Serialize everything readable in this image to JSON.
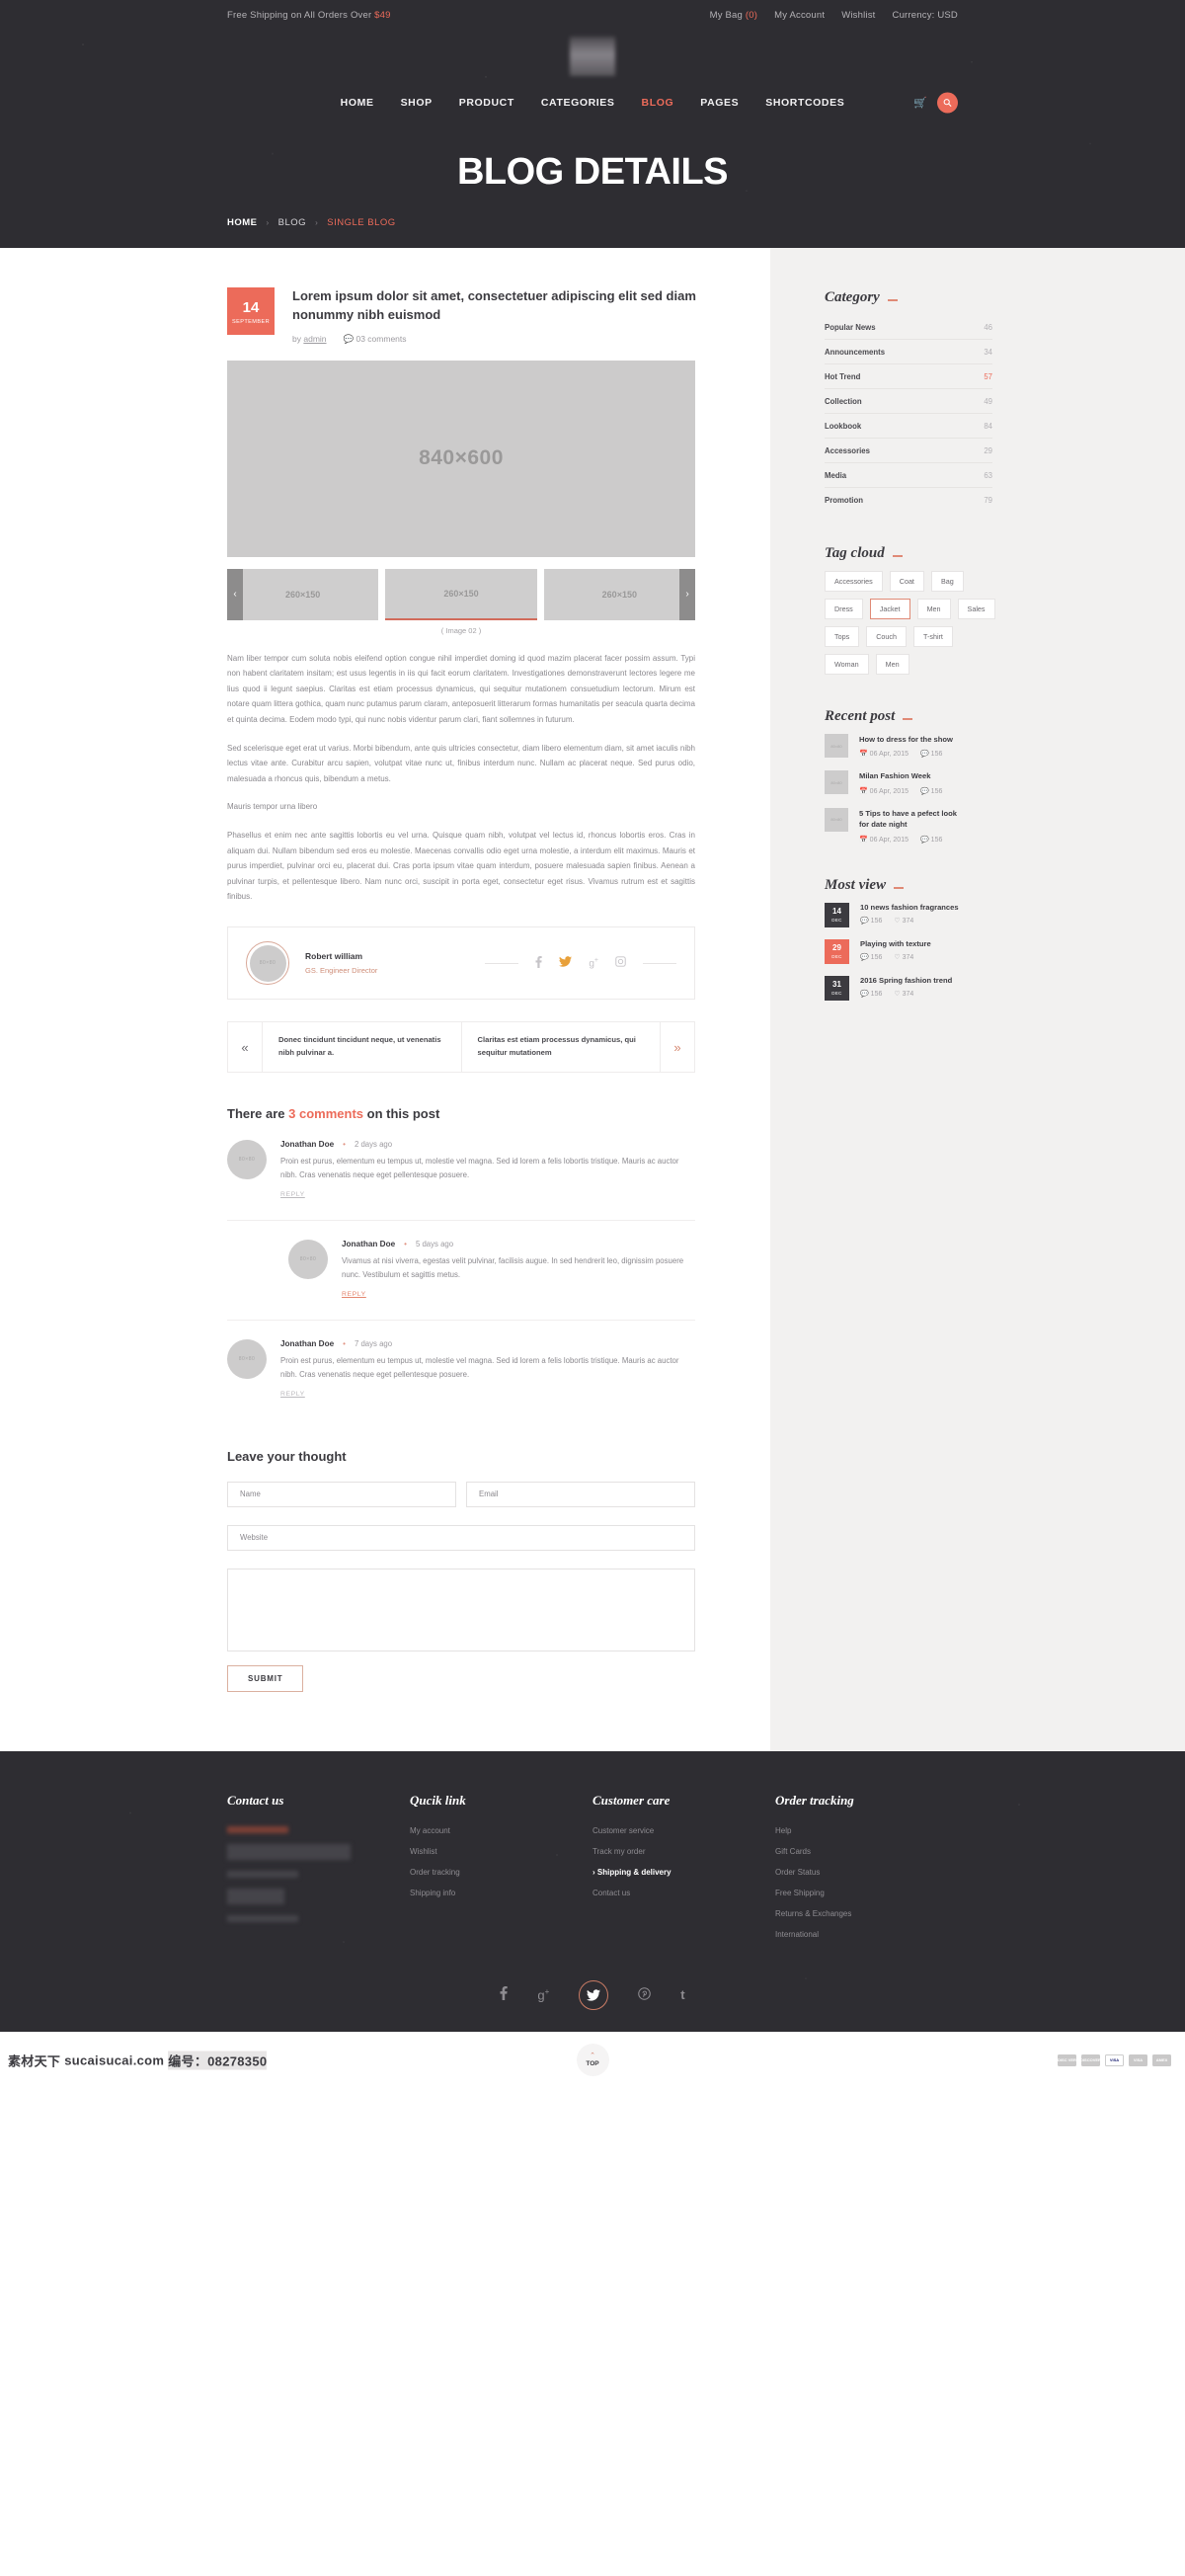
{
  "topbar": {
    "promo_prefix": "Free Shipping on All Orders Over ",
    "promo_amount": "$49",
    "bag_label": "My Bag ",
    "bag_count": "(0)",
    "account": "My Account",
    "wishlist": "Wishlist",
    "currency": "Currency: USD"
  },
  "nav": {
    "items": [
      {
        "label": "HOME"
      },
      {
        "label": "SHOP"
      },
      {
        "label": "PRODUCT"
      },
      {
        "label": "CATEGORIES"
      },
      {
        "label": "BLOG"
      },
      {
        "label": "PAGES"
      },
      {
        "label": "SHORTCODES"
      }
    ],
    "active": "BLOG",
    "cart_icon": "cart-icon",
    "search_icon": "search-icon"
  },
  "hero": {
    "title": "BLOG DETAILS",
    "breadcrumb": [
      {
        "label": "HOME"
      },
      {
        "label": "BLOG"
      },
      {
        "label": "SINGLE BLOG"
      }
    ]
  },
  "post": {
    "day": "14",
    "month": "SEPTEMBER",
    "title": "Lorem ipsum dolor sit amet, consectetuer adipiscing elit sed diam nonummy nibh euismod",
    "by_label": "by",
    "author": "admin",
    "comments_count": "03 comments",
    "feature_image_label": "840×600",
    "thumbs": [
      {
        "label": "260×150"
      },
      {
        "label": "260×150"
      },
      {
        "label": "260×150"
      }
    ],
    "prev_arrow": "‹",
    "next_arrow": "›",
    "image_caption": "( Image 02 )",
    "paragraphs": [
      "Nam liber tempor cum soluta nobis eleifend option congue nihil imperdiet doming id quod mazim placerat facer possim assum. Typi non habent claritatem insitam; est usus legentis in iis qui facit eorum claritatem. Investigationes demonstraverunt lectores legere me lius quod ii legunt saepius. Claritas est etiam processus dynamicus, qui sequitur mutationem consuetudium lectorum. Mirum est notare quam littera gothica, quam nunc putamus parum claram, anteposuerit litterarum formas humanitatis per seacula quarta decima et quinta decima. Eodem modo typi, qui nunc nobis videntur parum clari, fiant sollemnes in futurum.",
      "Sed scelerisque eget erat ut varius. Morbi bibendum, ante quis ultricies consectetur, diam libero elementum diam, sit amet iaculis nibh lectus vitae ante. Curabitur arcu sapien, volutpat vitae nunc ut, finibus interdum nunc. Nullam ac placerat neque. Sed purus odio, malesuada a rhoncus quis, bibendum a metus.",
      "Mauris tempor urna libero",
      "Phasellus et enim nec ante sagittis lobortis eu vel urna. Quisque quam nibh, volutpat vel lectus id, rhoncus lobortis eros. Cras in aliquam dui. Nullam bibendum sed eros eu molestie. Maecenas convallis odio eget urna molestie, a interdum elit maximus. Mauris et purus imperdiet, pulvinar orci eu, placerat dui. Cras porta ipsum vitae quam interdum, posuere malesuada sapien finibus. Aenean a pulvinar turpis, et pellentesque libero. Nam nunc orci, suscipit in porta eget, consectetur eget risus. Vivamus rutrum est et sagittis finibus."
    ]
  },
  "author_box": {
    "avatar_label": "80×80",
    "name": "Robert william",
    "role": "GS. Engineer Director",
    "socials": [
      {
        "icon": "facebook-icon",
        "glyph": "f"
      },
      {
        "icon": "twitter-icon",
        "glyph": "🐦"
      },
      {
        "icon": "google-plus-icon",
        "glyph": "g+"
      },
      {
        "icon": "instagram-icon",
        "glyph": "◙"
      }
    ]
  },
  "post_nav": {
    "prev_arrow": "«",
    "next_arrow": "»",
    "prev_text": "Donec tincidunt tincidunt neque, ut venenatis nibh pulvinar a.",
    "next_text": "Claritas est etiam processus dynamicus, qui sequitur mutationem"
  },
  "comments": {
    "heading_pre": "There are ",
    "heading_count": "3 comments",
    "heading_post": " on this post",
    "reply_label": "REPLY",
    "items": [
      {
        "avatar_label": "80×80",
        "name": "Jonathan Doe",
        "time": "2 days ago",
        "text": "Proin est purus, elementum eu tempus ut, molestie vel magna. Sed id lorem a felis lobortis tristique. Mauris ac auctor nibh. Cras venenatis neque eget pellentesque posuere.",
        "indent": false
      },
      {
        "avatar_label": "80×80",
        "name": "Jonathan Doe",
        "time": "5 days ago",
        "text": "Vivamus at nisi viverra, egestas velit pulvinar, facilisis augue. In sed hendrerit leo, dignissim posuere nunc. Vestibulum et sagittis metus.",
        "indent": true
      },
      {
        "avatar_label": "80×80",
        "name": "Jonathan Doe",
        "time": "7 days ago",
        "text": "Proin est purus, elementum eu tempus ut, molestie vel magna. Sed id lorem a felis lobortis tristique. Mauris ac auctor nibh. Cras venenatis neque eget pellentesque posuere.",
        "indent": false
      }
    ]
  },
  "comment_form": {
    "title": "Leave your thought",
    "name_placeholder": "Name",
    "email_placeholder": "Email",
    "website_placeholder": "Website",
    "message_placeholder": "",
    "submit_label": "SUBMIT"
  },
  "sidebar": {
    "category": {
      "title": "Category",
      "items": [
        {
          "label": "Popular News",
          "count": "46",
          "hot": false
        },
        {
          "label": "Announcements",
          "count": "34",
          "hot": false
        },
        {
          "label": "Hot Trend",
          "count": "57",
          "hot": true
        },
        {
          "label": "Collection",
          "count": "49",
          "hot": false
        },
        {
          "label": "Lookbook",
          "count": "84",
          "hot": false
        },
        {
          "label": "Accessories",
          "count": "29",
          "hot": false
        },
        {
          "label": "Media",
          "count": "63",
          "hot": false
        },
        {
          "label": "Promotion",
          "count": "79",
          "hot": false
        }
      ]
    },
    "tag_cloud": {
      "title": "Tag cloud",
      "tags": [
        {
          "label": "Accessories",
          "active": false
        },
        {
          "label": "Coat",
          "active": false
        },
        {
          "label": "Bag",
          "active": false
        },
        {
          "label": "Dress",
          "active": false
        },
        {
          "label": "Jacket",
          "active": true
        },
        {
          "label": "Men",
          "active": false
        },
        {
          "label": "Sales",
          "active": false
        },
        {
          "label": "Tops",
          "active": false
        },
        {
          "label": "Couch",
          "active": false
        },
        {
          "label": "T-shirt",
          "active": false
        },
        {
          "label": "Woman",
          "active": false
        },
        {
          "label": "Men",
          "active": false
        }
      ]
    },
    "recent_post": {
      "title": "Recent post",
      "items": [
        {
          "thumb_label": "80×80",
          "title": "How to dress for the show",
          "date": "06 Apr, 2015",
          "comments": "156"
        },
        {
          "thumb_label": "80×80",
          "title": "Milan Fashion Week",
          "date": "06 Apr, 2015",
          "comments": "156"
        },
        {
          "thumb_label": "80×80",
          "title": "5 Tips to have a pefect look for date night",
          "date": "06 Apr, 2015",
          "comments": "156"
        }
      ]
    },
    "most_view": {
      "title": "Most view",
      "items": [
        {
          "day": "14",
          "month": "DEC",
          "title": "10 news fashion fragrances",
          "comments": "156",
          "likes": "374",
          "highlight": false
        },
        {
          "day": "29",
          "month": "DEC",
          "title": "Playing with texture",
          "comments": "156",
          "likes": "374",
          "highlight": true
        },
        {
          "day": "31",
          "month": "DEC",
          "title": "2016 Spring fashion trend",
          "comments": "156",
          "likes": "374",
          "highlight": false
        }
      ]
    }
  },
  "footer": {
    "columns": [
      {
        "title": "Contact us",
        "links": [],
        "blurred": true
      },
      {
        "title": "Qucik link",
        "links": [
          {
            "label": "My account",
            "on": false
          },
          {
            "label": "Wishlist",
            "on": false
          },
          {
            "label": "Order tracking",
            "on": false
          },
          {
            "label": "Shipping info",
            "on": false
          }
        ],
        "blurred": false
      },
      {
        "title": "Customer care",
        "links": [
          {
            "label": "Customer service",
            "on": false
          },
          {
            "label": "Track my order",
            "on": false
          },
          {
            "label": "Shipping & delivery",
            "on": true
          },
          {
            "label": "Contact us",
            "on": false
          }
        ],
        "blurred": false
      },
      {
        "title": "Order tracking",
        "links": [
          {
            "label": "Help",
            "on": false
          },
          {
            "label": "Gift Cards",
            "on": false
          },
          {
            "label": "Order Status",
            "on": false
          },
          {
            "label": "Free Shipping",
            "on": false
          },
          {
            "label": "Returns & Exchanges",
            "on": false
          },
          {
            "label": "International",
            "on": false
          }
        ],
        "blurred": false
      }
    ],
    "socials": [
      {
        "icon": "facebook-icon",
        "glyph": "f",
        "highlight": false
      },
      {
        "icon": "google-plus-icon",
        "glyph": "g+",
        "highlight": false
      },
      {
        "icon": "twitter-icon",
        "glyph": "🐦",
        "highlight": true
      },
      {
        "icon": "pinterest-icon",
        "glyph": "℗",
        "highlight": false
      },
      {
        "icon": "tumblr-icon",
        "glyph": "t",
        "highlight": false
      }
    ]
  },
  "bottombar": {
    "credit_cn": "素材天下",
    "credit_site": "sucaisucai.com",
    "credit_no": "编号：08278350",
    "top_label": "TOP",
    "top_caret": "⌃",
    "payments": [
      {
        "label": "DISC VER",
        "name": "discover-card-icon"
      },
      {
        "label": "DISCOVER",
        "name": "discover-card-icon"
      },
      {
        "label": "VISA",
        "name": "visa-card-icon"
      },
      {
        "label": "VISA",
        "name": "visa-card-icon"
      },
      {
        "label": "AMEX",
        "name": "amex-card-icon"
      }
    ]
  },
  "colors": {
    "accent": "#ec6b5a",
    "dark": "#2e2d32",
    "sidebar_bg": "#f2f1f0",
    "muted": "#8b898e"
  }
}
